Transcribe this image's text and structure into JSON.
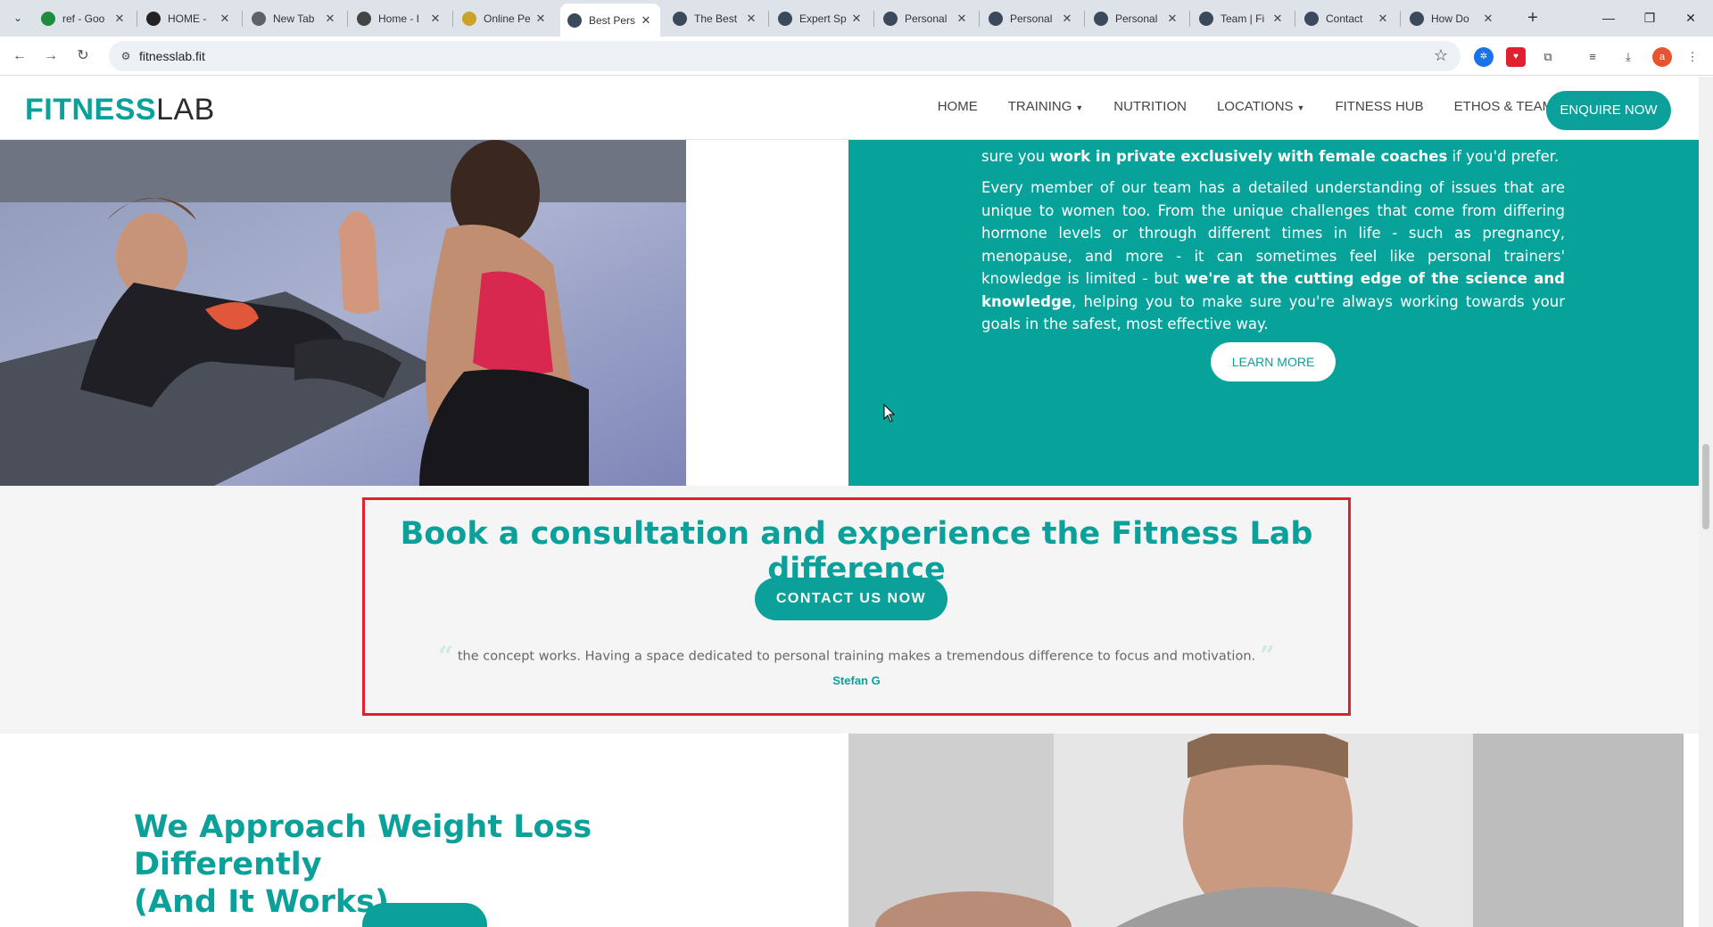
{
  "browser": {
    "tabs": [
      {
        "title": "ref - Goo",
        "icon": "sheets-icon",
        "color": "#1e8e3e"
      },
      {
        "title": "HOME -",
        "icon": "trm-icon",
        "color": "#222222"
      },
      {
        "title": "New Tab",
        "icon": "chrome-icon",
        "color": "#5f6368"
      },
      {
        "title": "Home - I",
        "icon": "site-icon",
        "color": "#444444"
      },
      {
        "title": "Online Pe",
        "icon": "figure-icon",
        "color": "#c9a227"
      },
      {
        "title": "Best Pers",
        "icon": "fitnesslab-icon",
        "color": "#3b4a5a"
      },
      {
        "title": "The Best",
        "icon": "fitnesslab-icon",
        "color": "#3b4a5a"
      },
      {
        "title": "Expert Sp",
        "icon": "fitnesslab-icon",
        "color": "#3b4a5a"
      },
      {
        "title": "Personal",
        "icon": "fitnesslab-icon",
        "color": "#3b4a5a"
      },
      {
        "title": "Personal",
        "icon": "fitnesslab-icon",
        "color": "#3b4a5a"
      },
      {
        "title": "Personal",
        "icon": "fitnesslab-icon",
        "color": "#3b4a5a"
      },
      {
        "title": "Team | Fi",
        "icon": "fitnesslab-icon",
        "color": "#3b4a5a"
      },
      {
        "title": "Contact",
        "icon": "fitnesslab-icon",
        "color": "#3b4a5a"
      },
      {
        "title": "How Do",
        "icon": "fitnesslab-icon",
        "color": "#3b4a5a"
      }
    ],
    "active_tab_index": 5,
    "url": "fitnesslab.fit"
  },
  "site": {
    "logo_bold": "FITNESS",
    "logo_light": "LAB",
    "nav": [
      {
        "label": "HOME",
        "dropdown": false
      },
      {
        "label": "TRAINING",
        "dropdown": true
      },
      {
        "label": "NUTRITION",
        "dropdown": false
      },
      {
        "label": "LOCATIONS",
        "dropdown": true
      },
      {
        "label": "FITNESS HUB",
        "dropdown": false
      },
      {
        "label": "ETHOS & TEAM",
        "dropdown": true
      }
    ],
    "enquire_label": "ENQUIRE NOW",
    "accent_color": "#0ca09a"
  },
  "teal_panel": {
    "para1_pre": "sure you ",
    "para1_bold": "work in private exclusively with female coaches",
    "para1_post": " if you'd prefer.",
    "para2_pre": "Every member of our team has a detailed understanding of issues that are unique to women too. From the unique challenges that come from differing hormone levels or through different times in life - such as pregnancy, menopause, and more - it can sometimes feel like personal trainers' knowledge is limited - but ",
    "para2_bold": "we're at the cutting edge of the science and knowledge",
    "para2_post": ", helping you to make sure you're always working towards your goals in the safest, most effective way.",
    "learn_more": "LEARN MORE"
  },
  "cta": {
    "title": "Book a consultation and experience the Fitness Lab difference",
    "button": "CONTACT US NOW",
    "quote": "the concept works. Having a space dedicated to personal training makes a tremendous difference to focus and motivation.",
    "author": "Stefan G"
  },
  "weight_loss": {
    "heading_line1": "We Approach Weight Loss Differently",
    "heading_line2": "(And It Works)"
  }
}
